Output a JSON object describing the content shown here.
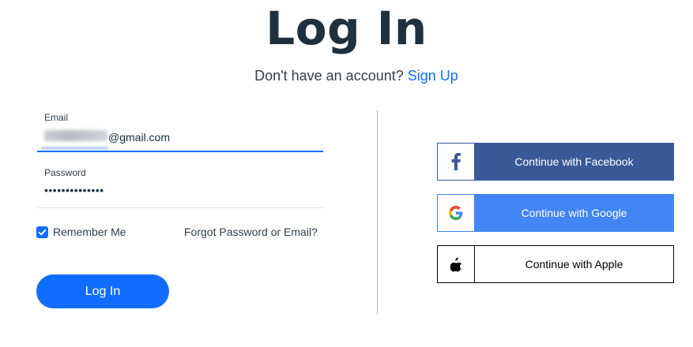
{
  "header": {
    "title": "Log In",
    "signup_prompt": "Don't have an account?",
    "signup_link": "Sign Up"
  },
  "form": {
    "email_label": "Email",
    "email_value_visible": "@gmail.com",
    "password_label": "Password",
    "password_value": "••••••••••••••",
    "remember_label": "Remember Me",
    "remember_checked": true,
    "forgot_link": "Forgot Password or Email?",
    "login_button": "Log In"
  },
  "social": {
    "facebook": "Continue with Facebook",
    "google": "Continue with Google",
    "apple": "Continue with Apple"
  },
  "colors": {
    "accent": "#116dff",
    "facebook": "#3b5998",
    "google": "#4285f4",
    "apple": "#000000"
  }
}
